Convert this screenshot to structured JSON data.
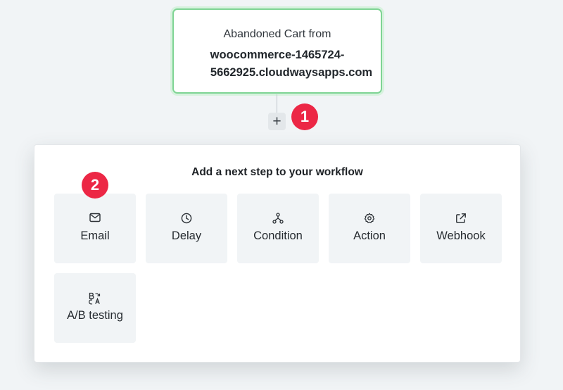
{
  "trigger": {
    "line1": "Abandoned Cart from",
    "line2a": "woocommerce-1465724-",
    "line2b": "5662925.cloudwaysapps.com"
  },
  "add_button": {
    "label": "+"
  },
  "markers": {
    "one": "1",
    "two": "2"
  },
  "panel": {
    "title": "Add a next step to your workflow",
    "options": [
      {
        "label": "Email",
        "icon": "mail-icon"
      },
      {
        "label": "Delay",
        "icon": "clock-icon"
      },
      {
        "label": "Condition",
        "icon": "branch-icon"
      },
      {
        "label": "Action",
        "icon": "gear-icon"
      },
      {
        "label": "Webhook",
        "icon": "external-link-icon"
      },
      {
        "label": "A/B testing",
        "icon": "ab-icon"
      }
    ]
  },
  "colors": {
    "background": "#f1f4f6",
    "trigger_border": "#7fd494",
    "marker": "#ec2745",
    "tile": "#f1f4f6"
  }
}
